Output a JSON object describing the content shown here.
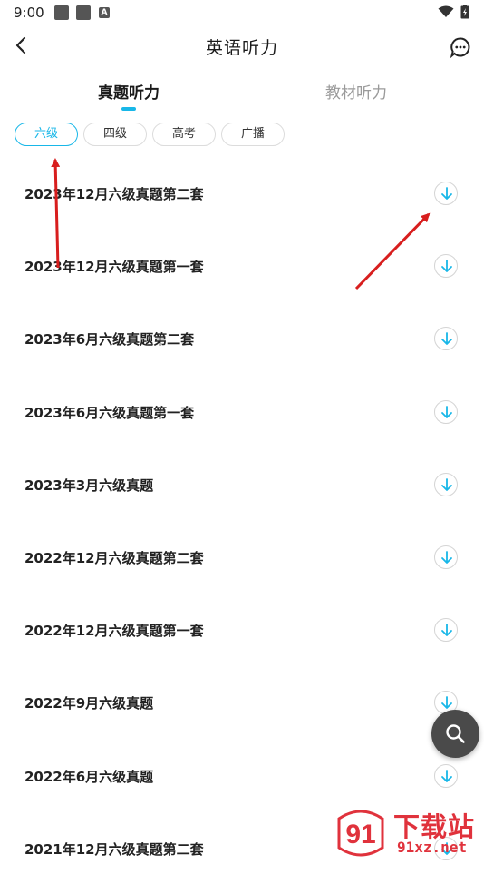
{
  "status_bar": {
    "time": "9:00",
    "notif_letter": "A"
  },
  "header": {
    "title": "英语听力"
  },
  "tabs": [
    {
      "label": "真题听力",
      "active": true
    },
    {
      "label": "教材听力",
      "active": false
    }
  ],
  "filters": [
    {
      "label": "六级",
      "active": true
    },
    {
      "label": "四级",
      "active": false
    },
    {
      "label": "高考",
      "active": false
    },
    {
      "label": "广播",
      "active": false
    }
  ],
  "items": [
    {
      "title": "2023年12月六级真题第二套"
    },
    {
      "title": "2023年12月六级真题第一套"
    },
    {
      "title": "2023年6月六级真题第二套"
    },
    {
      "title": "2023年6月六级真题第一套"
    },
    {
      "title": "2023年3月六级真题"
    },
    {
      "title": "2022年12月六级真题第二套"
    },
    {
      "title": "2022年12月六级真题第一套"
    },
    {
      "title": "2022年9月六级真题"
    },
    {
      "title": "2022年6月六级真题"
    },
    {
      "title": "2021年12月六级真题第二套"
    }
  ],
  "watermark": {
    "logo_text": "91",
    "site_name": "下载站",
    "url": "91xz.net"
  },
  "colors": {
    "accent": "#18b7e8",
    "annotation": "#d81e1e",
    "watermark": "#e0323c"
  }
}
